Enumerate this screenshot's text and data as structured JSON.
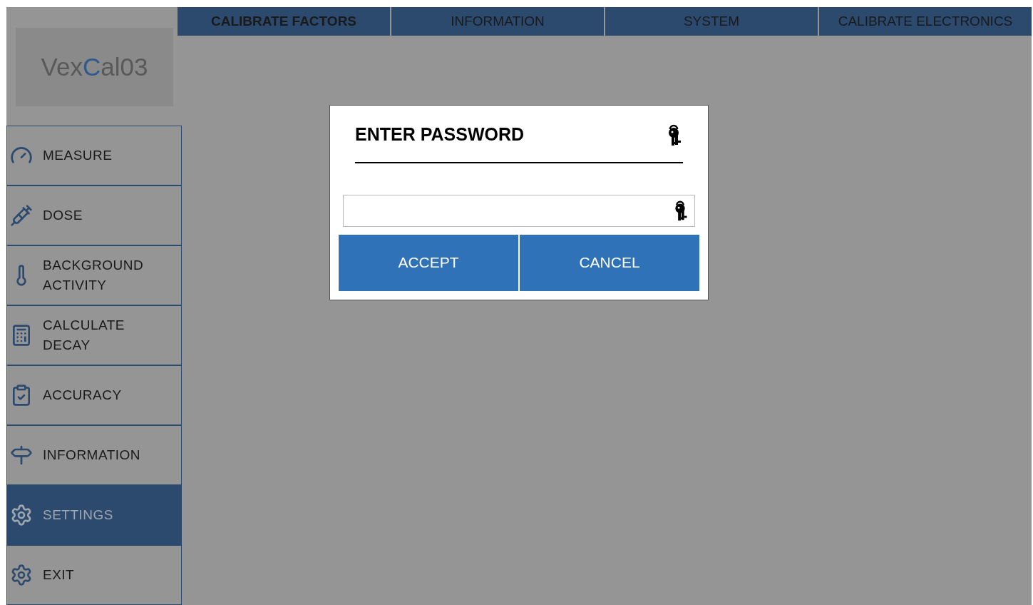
{
  "logo": [
    {
      "text": "Vex",
      "accent": false
    },
    {
      "text": "C",
      "accent": true
    },
    {
      "text": "al03",
      "accent": false
    }
  ],
  "tabs": [
    {
      "label": "CALIBRATE FACTORS",
      "selected": true
    },
    {
      "label": "INFORMATION",
      "selected": false
    },
    {
      "label": "SYSTEM",
      "selected": false
    },
    {
      "label": "CALIBRATE ELECTRONICS",
      "selected": false
    }
  ],
  "sidebar": {
    "items": [
      {
        "label": "MEASURE",
        "selected": false
      },
      {
        "label": "DOSE",
        "selected": false
      },
      {
        "label": "BACKGROUND ACTIVITY",
        "selected": false
      },
      {
        "label": "CALCULATE DECAY",
        "selected": false
      },
      {
        "label": "ACCURACY",
        "selected": false
      },
      {
        "label": "INFORMATION",
        "selected": false
      },
      {
        "label": "SETTINGS",
        "selected": true
      },
      {
        "label": "EXIT",
        "selected": false
      }
    ]
  },
  "dialog": {
    "title": "ENTER PASSWORD",
    "buttons": [
      "ACCEPT",
      "CANCEL"
    ]
  }
}
